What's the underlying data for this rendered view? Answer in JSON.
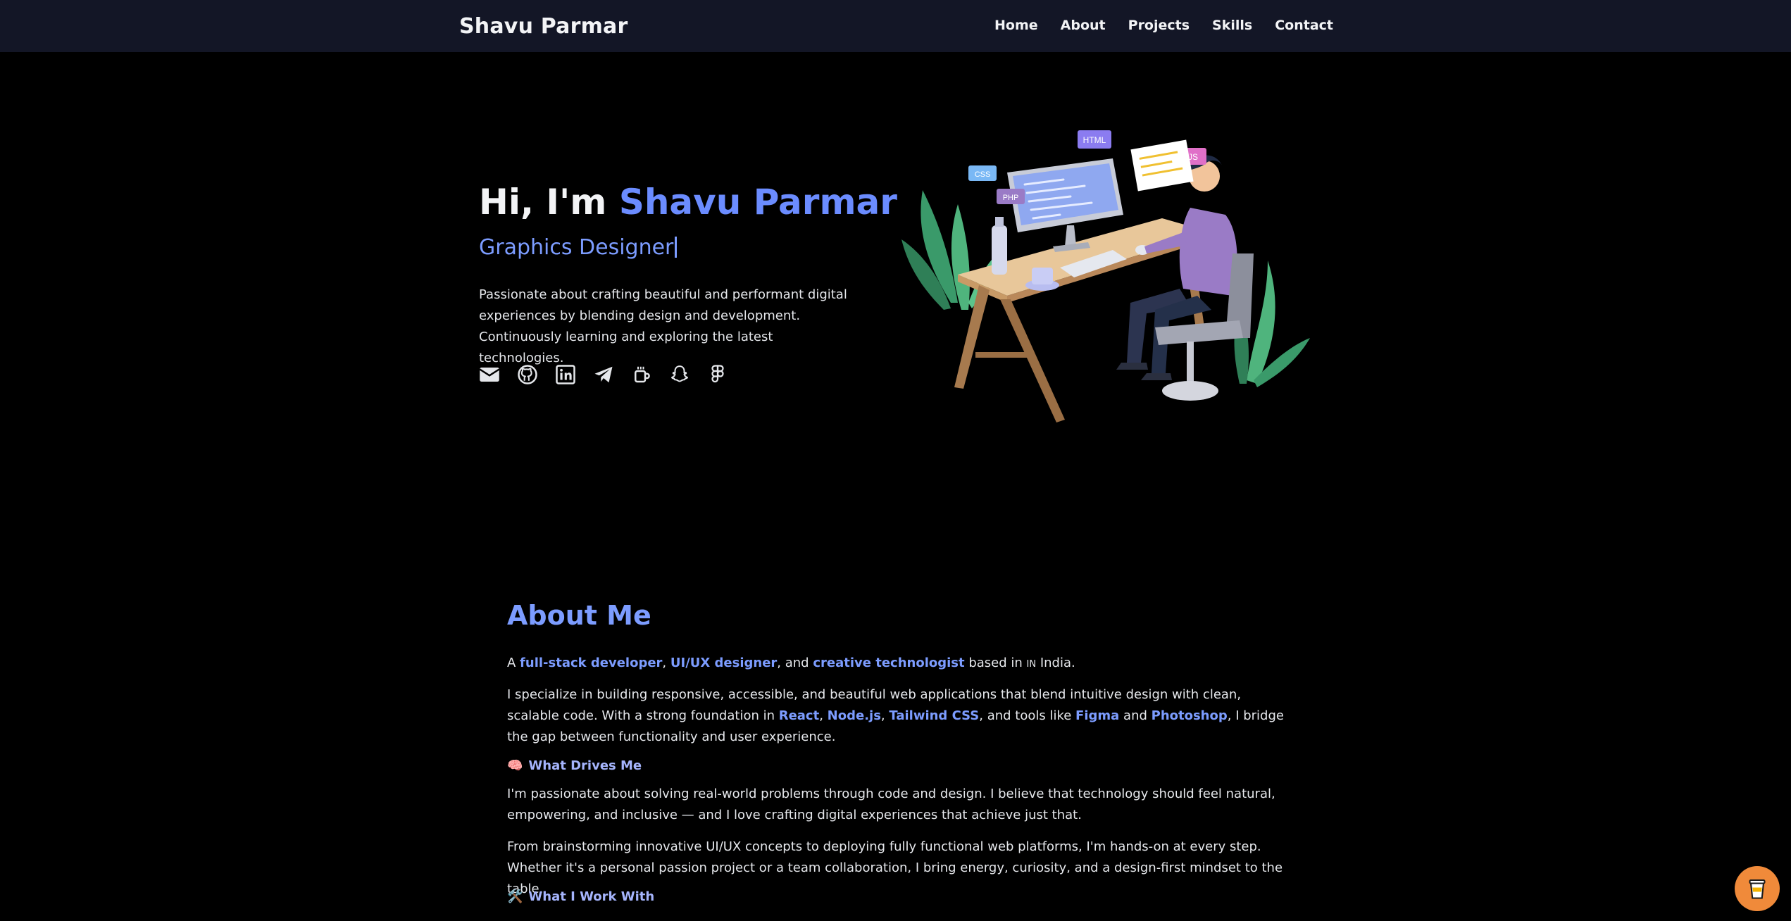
{
  "nav": {
    "brand": "Shavu Parmar",
    "links": [
      "Home",
      "About",
      "Projects",
      "Skills",
      "Contact"
    ]
  },
  "hero": {
    "greeting": "Hi, I'm ",
    "name": "Shavu Parmar",
    "role": "Graphics Designer",
    "intro": "Passionate about crafting beautiful and performant digital experiences by blending design and development. Continuously learning and exploring the latest technologies.",
    "socials": [
      "mail-icon",
      "github-icon",
      "linkedin-icon",
      "telegram-icon",
      "coffee-cup-icon",
      "snapchat-icon",
      "figma-icon"
    ],
    "illustration_labels": [
      "HTML",
      "CSS",
      "PHP",
      "JS"
    ]
  },
  "about": {
    "title": "About Me",
    "line1": {
      "a": "A ",
      "h1": "full-stack developer",
      "sep1": ", ",
      "h2": "UI/UX designer",
      "sep2": ", and ",
      "h3": "creative technologist",
      "tail": " based in ",
      "flag": "IN",
      "country": " India."
    },
    "line2": {
      "p1": "I specialize in building responsive, accessible, and beautiful web applications that blend intuitive design with clean, scalable code. With a strong foundation in ",
      "t1": "React",
      "c1": ", ",
      "t2": "Node.js",
      "c2": ", ",
      "t3": "Tailwind CSS",
      "p2": ", and tools like ",
      "t4": "Figma",
      "p3": " and ",
      "t5": "Photoshop",
      "p4": ", I bridge the gap between functionality and user experience."
    },
    "drives_title": "What Drives Me",
    "drives_emoji": "🧠",
    "drives_text1": "I'm passionate about solving real-world problems through code and design. I believe that technology should feel natural, empowering, and inclusive — and I love crafting digital experiences that achieve just that.",
    "drives_text2": "From brainstorming innovative UI/UX concepts to deploying fully functional web platforms, I'm hands-on at every step. Whether it's a personal passion project or a team collaboration, I bring energy, curiosity, and a design-first mindset to the table.",
    "work_title": "What I Work With",
    "work_emoji": "🛠️"
  },
  "colors": {
    "accent": "#6b8cff",
    "nav_bg": "#131626",
    "coffee_button": "#f08a3a"
  }
}
